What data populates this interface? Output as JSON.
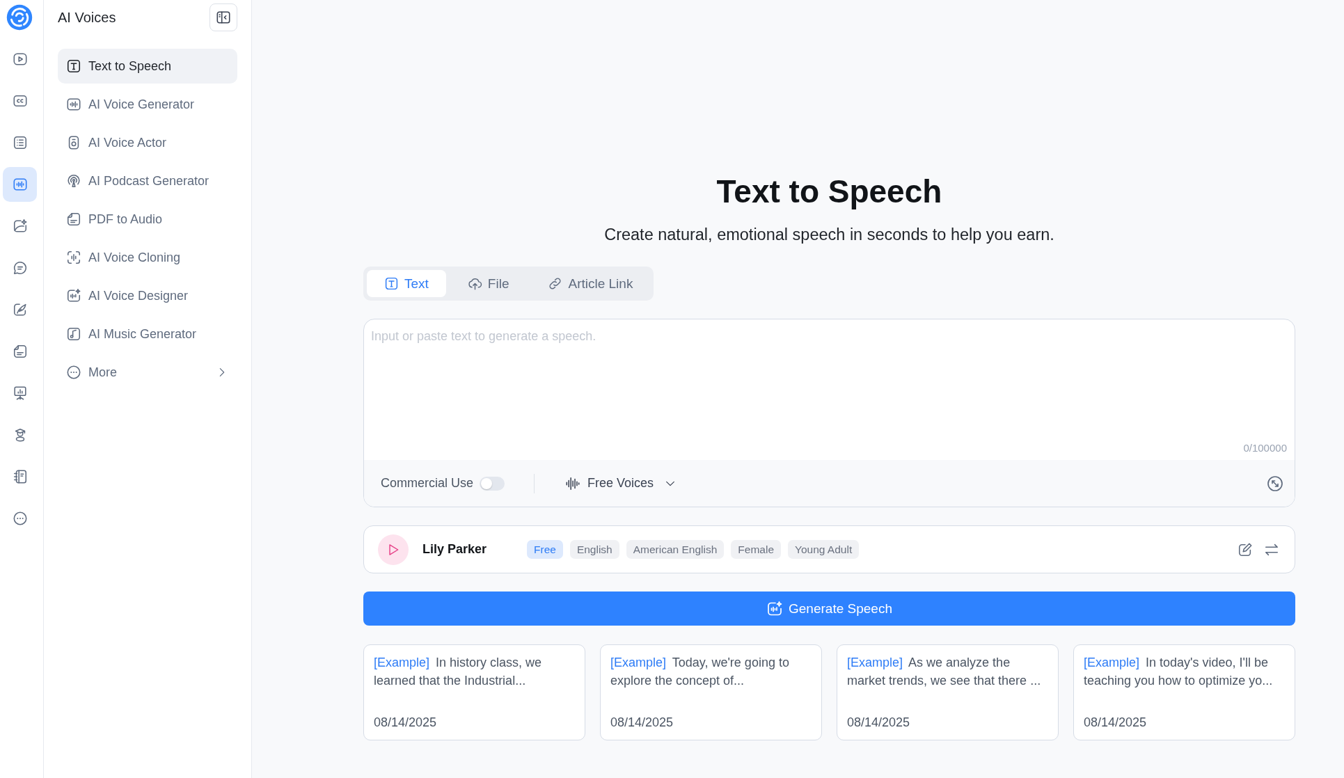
{
  "rail": {
    "items": [
      {
        "selected": false
      },
      {
        "selected": false
      },
      {
        "selected": false
      },
      {
        "selected": true
      },
      {
        "selected": false
      },
      {
        "selected": false
      },
      {
        "selected": false
      },
      {
        "selected": false
      },
      {
        "selected": false
      },
      {
        "selected": false
      },
      {
        "selected": false
      },
      {
        "selected": false
      }
    ]
  },
  "sidebar": {
    "title": "AI Voices",
    "items": [
      {
        "label": "Text to Speech",
        "selected": true
      },
      {
        "label": "AI Voice Generator",
        "selected": false
      },
      {
        "label": "AI Voice Actor",
        "selected": false
      },
      {
        "label": "AI Podcast Generator",
        "selected": false
      },
      {
        "label": "PDF to Audio",
        "selected": false
      },
      {
        "label": "AI Voice Cloning",
        "selected": false
      },
      {
        "label": "AI Voice Designer",
        "selected": false
      },
      {
        "label": "AI Music Generator",
        "selected": false
      }
    ],
    "more_item": {
      "label": "More"
    }
  },
  "page": {
    "title": "Text to Speech",
    "subtitle": "Create natural, emotional speech in seconds to help you earn."
  },
  "tabs": [
    {
      "label": "Text",
      "selected": true
    },
    {
      "label": "File",
      "selected": false
    },
    {
      "label": "Article Link",
      "selected": false
    }
  ],
  "editor": {
    "placeholder": "Input or paste text to generate a speech.",
    "counter": "0/100000",
    "commercial_use": {
      "label": "Commercial Use",
      "on": false
    },
    "voice_filter": {
      "label": "Free Voices"
    }
  },
  "voice": {
    "name": "Lily Parker",
    "tags": [
      {
        "label": "Free",
        "kind": "accent"
      },
      {
        "label": "English",
        "kind": "plain"
      },
      {
        "label": "American English",
        "kind": "plain"
      },
      {
        "label": "Female",
        "kind": "plain"
      },
      {
        "label": "Young Adult",
        "kind": "plain"
      }
    ]
  },
  "generate_button": {
    "label": "Generate Speech"
  },
  "examples": [
    {
      "tag": "[Example]",
      "text": "In history class, we learned that the Industrial...",
      "date": "08/14/2025"
    },
    {
      "tag": "[Example]",
      "text": "Today, we're going to explore the concept of...",
      "date": "08/14/2025"
    },
    {
      "tag": "[Example]",
      "text": "As we analyze the market trends, we see that there ...",
      "date": "08/14/2025"
    },
    {
      "tag": "[Example]",
      "text": "In today's video, I'll be teaching you how to optimize yo...",
      "date": "08/14/2025"
    }
  ]
}
